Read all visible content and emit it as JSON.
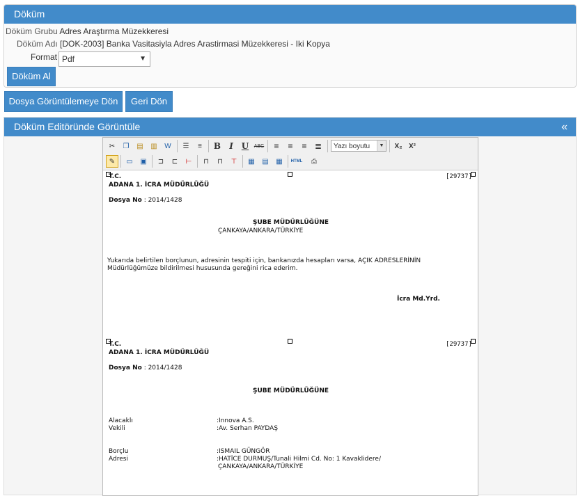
{
  "panel1": {
    "title": "Döküm",
    "group_label": "Döküm Grubu",
    "group_value": "Adres Araştırma Müzekkeresi",
    "name_label": "Döküm Adı",
    "name_value": "[DOK-2003] Banka Vasitasiyla Adres Arastirmasi Müzekkeresi - Iki Kopya",
    "format_label": "Format",
    "format_value": "Pdf",
    "print_button": "Döküm Al"
  },
  "nav": {
    "back_to_file": "Dosya Görüntülemeye Dön",
    "back": "Geri Dön"
  },
  "panel2": {
    "title": "Döküm Editöründe Görüntüle",
    "collapse": "«"
  },
  "toolbar": {
    "font_size": "Yazı boyutu",
    "icons": [
      "cut-icon",
      "copy-icon",
      "paste-icon",
      "paste-text-icon",
      "paste-word-icon",
      "bullet-list-icon",
      "numbered-list-icon",
      "bold-icon",
      "italic-icon",
      "underline-icon",
      "strikethrough-icon",
      "align-left-icon",
      "align-center-icon",
      "align-right-icon",
      "justify-icon",
      "subscript-icon",
      "superscript-icon"
    ]
  },
  "doc": {
    "tc": "T.C.",
    "office": "ADANA 1. İCRA MÜDÜRLÜĞÜ",
    "dosya_label": "Dosya No",
    "dosya_value": ": 2014/1428",
    "ref": "[29737]",
    "sube": "ŞUBE MÜDÜRLÜĞÜNE",
    "overlap_line": "ÇANKAYA/ANKARA/TÜRKİYE",
    "body1": "Yukarıda belirtilen borçlunun, adresinin tespiti için, bankanızda hesapları varsa, AÇIK ADRESLERİNİN",
    "body2": "Müdürlüğümüze bildirilmesi hususunda gereğini rica ederim.",
    "signer": "İcra Md.Yrd.",
    "alacakli_label": "Alacaklı",
    "alacakli_value": ":Innova A.S.",
    "vekili_label": "Vekili",
    "vekili_value": ":Av. Serhan PAYDAŞ",
    "borclu_label": "Borçlu",
    "borclu_value": ":ISMAIL GÜNGÖR",
    "adresi_label": "Adresi",
    "adresi_value": ":HATİCE DURMUŞ/Tunali Hilmi Cd. No: 1 Kavaklidere/",
    "adresi_value2": "ÇANKAYA/ANKARA/TÜRKİYE"
  }
}
